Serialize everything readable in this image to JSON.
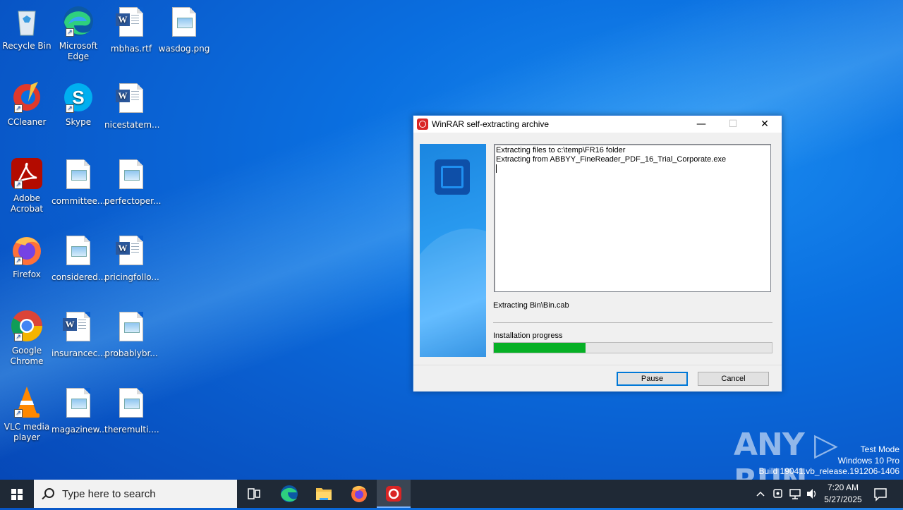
{
  "desktop": {
    "icons": [
      {
        "label": "Recycle Bin",
        "icon": "recycle-bin-icon"
      },
      {
        "label": "Microsoft Edge",
        "icon": "edge-icon"
      },
      {
        "label": "mbhas.rtf",
        "icon": "word-document-icon"
      },
      {
        "label": "wasdog.png",
        "icon": "image-file-icon"
      },
      {
        "label": "CCleaner",
        "icon": "ccleaner-icon"
      },
      {
        "label": "Skype",
        "icon": "skype-icon"
      },
      {
        "label": "nicestatem...",
        "icon": "word-document-icon"
      },
      {
        "label": "Adobe Acrobat",
        "icon": "acrobat-icon"
      },
      {
        "label": "committee...",
        "icon": "image-file-icon"
      },
      {
        "label": "perfectoper...",
        "icon": "image-file-icon"
      },
      {
        "label": "Firefox",
        "icon": "firefox-icon"
      },
      {
        "label": "considered...",
        "icon": "image-file-icon"
      },
      {
        "label": "pricingfollo...",
        "icon": "word-document-icon"
      },
      {
        "label": "Google Chrome",
        "icon": "chrome-icon"
      },
      {
        "label": "insurancec...",
        "icon": "word-document-icon"
      },
      {
        "label": "probablybr...",
        "icon": "image-file-icon"
      },
      {
        "label": "VLC media player",
        "icon": "vlc-icon"
      },
      {
        "label": "magazinew...",
        "icon": "image-file-icon"
      },
      {
        "label": "theremulti....",
        "icon": "image-file-icon"
      }
    ]
  },
  "window": {
    "title": "WinRAR self-extracting archive",
    "log_lines": [
      "Extracting files to c:\\temp\\FR16 folder",
      "Extracting from ABBYY_FineReader_PDF_16_Trial_Corporate.exe"
    ],
    "status": "Extracting Bin\\Bin.cab",
    "progress_label": "Installation progress",
    "progress_fraction": 0.33,
    "pause_label": "Pause",
    "cancel_label": "Cancel",
    "accent": "#06b025"
  },
  "watermark": {
    "brand": "ANY RUN",
    "line1": "Test Mode",
    "line2": "Windows 10 Pro",
    "line3": "Build 19041.vb_release.191206-1406"
  },
  "taskbar": {
    "search_placeholder": "Type here to search",
    "time": "7:20 AM",
    "date": "5/27/2025"
  }
}
